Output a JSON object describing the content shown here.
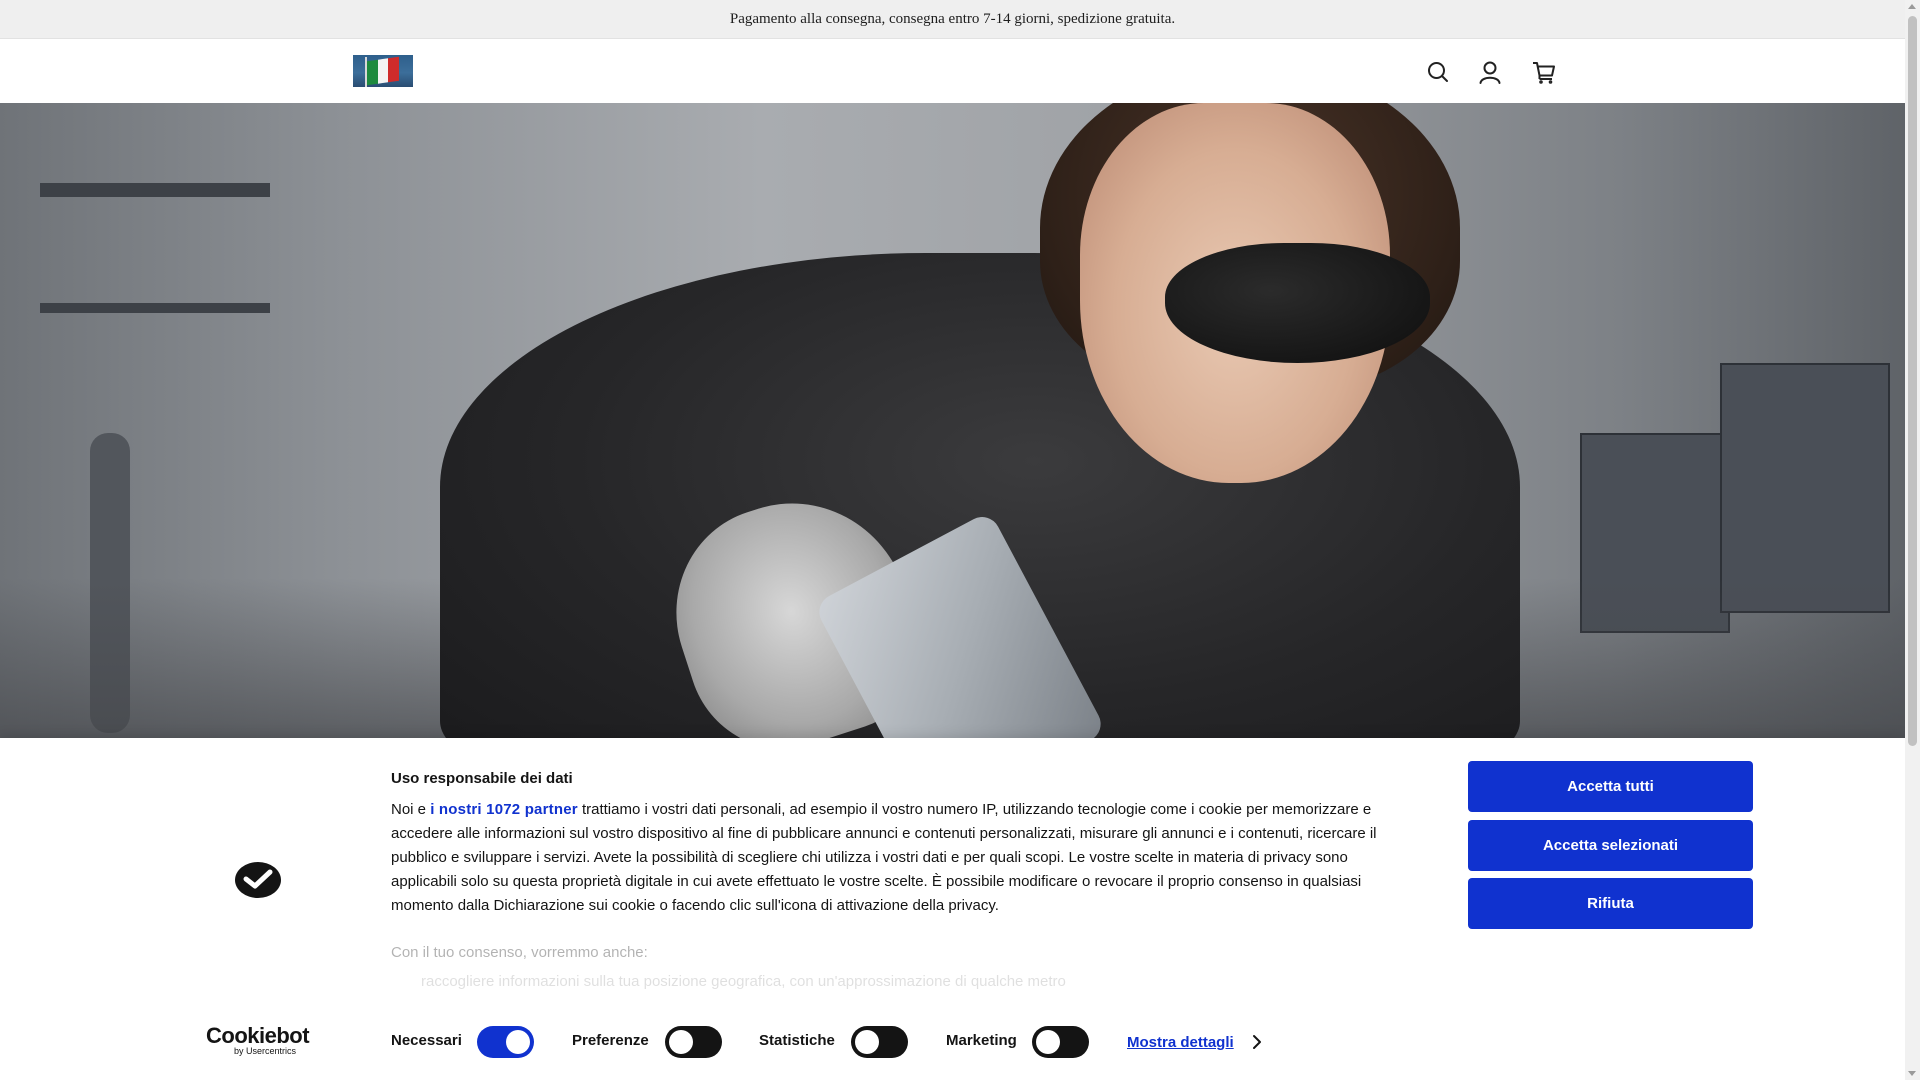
{
  "announcement": {
    "text": "Pagamento alla consegna, consegna entro 7-14 giorni, spedizione gratuita."
  },
  "header": {
    "logo_icon": "italian-flag-logo",
    "icons": [
      "search-icon",
      "account-icon",
      "cart-icon"
    ]
  },
  "hero": {
    "image": "worker-with-handheld-laser-welder-photo"
  },
  "cookie": {
    "title": "Uso responsabile dei dati",
    "text_before": "Noi e ",
    "partners_link": "i nostri 1072 partner",
    "text_after": " trattiamo i vostri dati personali, ad esempio il vostro numero IP, utilizzando tecnologie come i cookie per memorizzare e accedere alle informazioni sul vostro dispositivo al fine di pubblicare annunci e contenuti personalizzati, misurare gli annunci e i contenuti, ricercare il pubblico e sviluppare i servizi. Avete la possibilità di scegliere chi utilizza i vostri dati e per quali scopi. Le vostre scelte in materia di privacy sono applicabili solo su questa proprietà digitale in cui avete effettuato le vostre scelte. È possibile modificare o revocare il proprio consenso in qualsiasi momento dalla Dichiarazione sui cookie o facendo clic sull'icona di attivazione della privacy.",
    "consent_subtitle": "Con il tuo consenso, vorremmo anche:",
    "consent_item": "raccogliere informazioni sulla tua posizione geografica, con un'approssimazione di qualche metro",
    "buttons": {
      "accept_all": "Accetta tutti",
      "accept_selected": "Accetta selezionati",
      "reject": "Rifiuta"
    },
    "toggles": [
      {
        "label": "Necessari",
        "on": true
      },
      {
        "label": "Preferenze",
        "on": false
      },
      {
        "label": "Statistiche",
        "on": false
      },
      {
        "label": "Marketing",
        "on": false
      }
    ],
    "details_link": "Mostra dettagli",
    "brand": {
      "name": "Cookiebot",
      "byline": "by Usercentrics"
    },
    "accent_color": "#1032cf"
  }
}
